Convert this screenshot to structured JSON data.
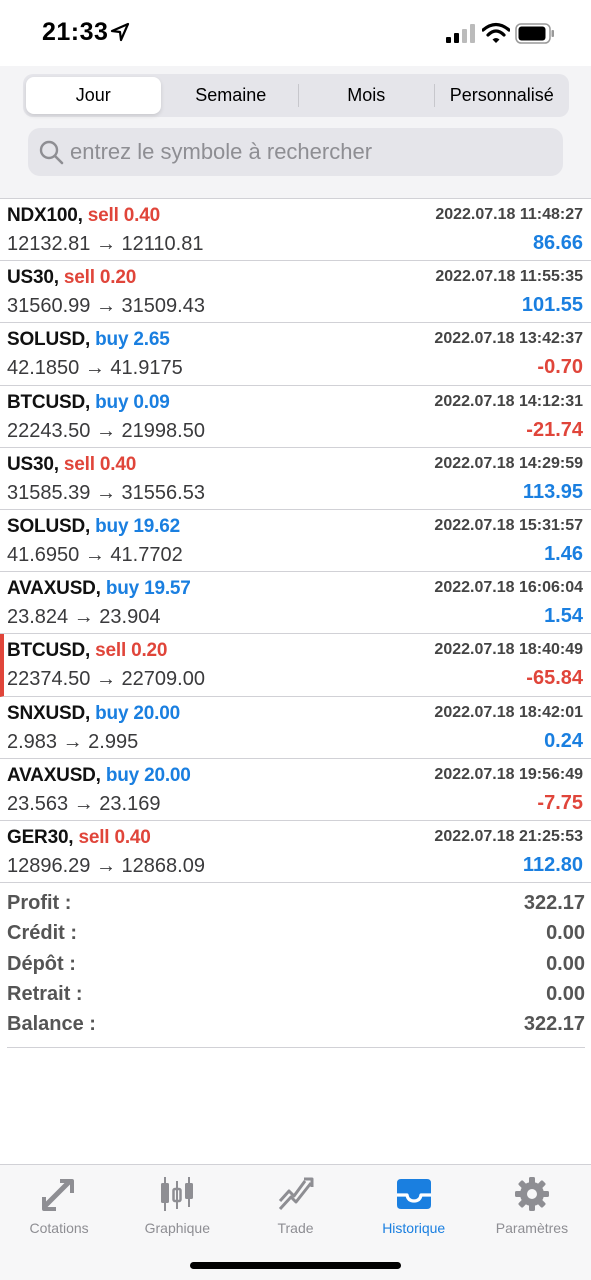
{
  "status": {
    "time": "21:33"
  },
  "tabs_period": [
    "Jour",
    "Semaine",
    "Mois",
    "Personnalisé"
  ],
  "search": {
    "placeholder": "entrez le symbole à rechercher"
  },
  "trades": [
    {
      "symbol": "NDX100,",
      "side": "sell 0.40",
      "date": "2022.07.18 11:48:27",
      "prices": "12132.81 → 12110.81",
      "profit": "86.66"
    },
    {
      "symbol": "US30,",
      "side": "sell 0.20",
      "date": "2022.07.18 11:55:35",
      "prices": "31560.99 → 31509.43",
      "profit": "101.55"
    },
    {
      "symbol": "SOLUSD,",
      "side": "buy 2.65",
      "date": "2022.07.18 13:42:37",
      "prices": "42.1850 → 41.9175",
      "profit": "-0.70"
    },
    {
      "symbol": "BTCUSD,",
      "side": "buy 0.09",
      "date": "2022.07.18 14:12:31",
      "prices": "22243.50 → 21998.50",
      "profit": "-21.74"
    },
    {
      "symbol": "US30,",
      "side": "sell 0.40",
      "date": "2022.07.18 14:29:59",
      "prices": "31585.39 → 31556.53",
      "profit": "113.95"
    },
    {
      "symbol": "SOLUSD,",
      "side": "buy 19.62",
      "date": "2022.07.18 15:31:57",
      "prices": "41.6950 → 41.7702",
      "profit": "1.46"
    },
    {
      "symbol": "AVAXUSD,",
      "side": "buy 19.57",
      "date": "2022.07.18 16:06:04",
      "prices": "23.824 → 23.904",
      "profit": "1.54"
    },
    {
      "symbol": "BTCUSD,",
      "side": "sell 0.20",
      "date": "2022.07.18 18:40:49",
      "prices": "22374.50 → 22709.00",
      "profit": "-65.84"
    },
    {
      "symbol": "SNXUSD,",
      "side": "buy 20.00",
      "date": "2022.07.18 18:42:01",
      "prices": "2.983 → 2.995",
      "profit": "0.24"
    },
    {
      "symbol": "AVAXUSD,",
      "side": "buy 20.00",
      "date": "2022.07.18 19:56:49",
      "prices": "23.563 → 23.169",
      "profit": "-7.75"
    },
    {
      "symbol": "GER30,",
      "side": "sell 0.40",
      "date": "2022.07.18 21:25:53",
      "prices": "12896.29 → 12868.09",
      "profit": "112.80"
    }
  ],
  "summary": [
    {
      "label": "Profit :",
      "value": "322.17"
    },
    {
      "label": "Crédit :",
      "value": "0.00"
    },
    {
      "label": "Dépôt :",
      "value": "0.00"
    },
    {
      "label": "Retrait :",
      "value": "0.00"
    },
    {
      "label": "Balance :",
      "value": "322.17"
    }
  ],
  "tabbar": [
    "Cotations",
    "Graphique",
    "Trade",
    "Historique",
    "Paramètres"
  ],
  "colors": {
    "buy": "#1a7fe0",
    "sell": "#e0453a",
    "accent": "#1a7fe0"
  }
}
